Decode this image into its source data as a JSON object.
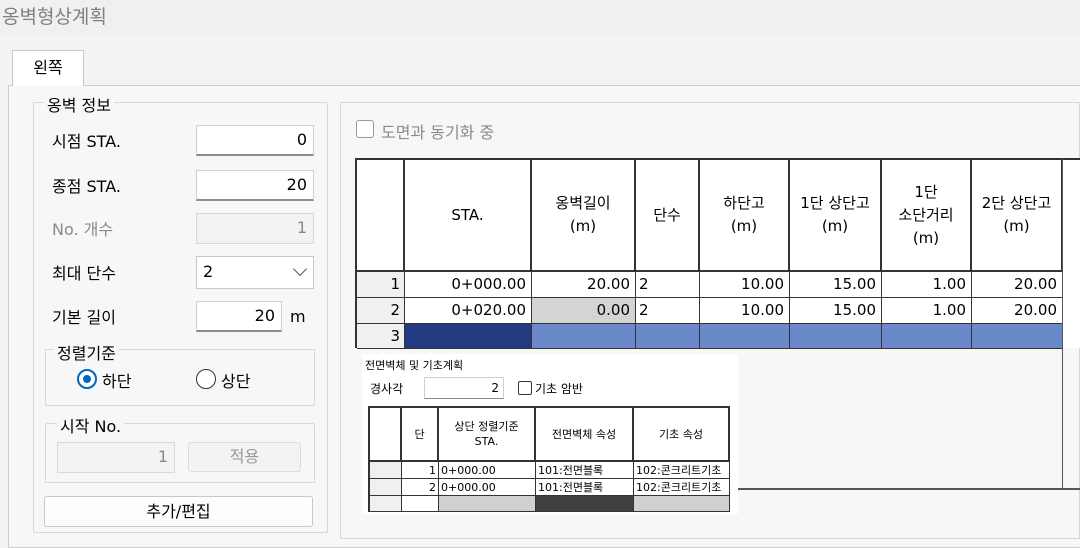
{
  "window": {
    "title": "옹벽형상계획"
  },
  "tabs": [
    {
      "label": "왼쪽"
    }
  ],
  "wall_info": {
    "group_label": "옹벽 정보",
    "start_sta": {
      "label": "시점 STA.",
      "value": "0"
    },
    "end_sta": {
      "label": "종점 STA.",
      "value": "20"
    },
    "count": {
      "label": "No. 개수",
      "value": "1"
    },
    "max_tiers": {
      "label": "최대 단수",
      "value": "2"
    },
    "base_length": {
      "label": "기본 길이",
      "value": "20",
      "unit": "m"
    },
    "alignment": {
      "group_label": "정렬기준",
      "options": [
        {
          "label": "하단",
          "selected": true
        },
        {
          "label": "상단",
          "selected": false
        }
      ]
    },
    "start_no": {
      "group_label": "시작 No.",
      "value": "1",
      "apply_label": "적용"
    },
    "add_edit_label": "추가/편집"
  },
  "sync": {
    "label": "도면과 동기화 중",
    "checked": false
  },
  "main_table": {
    "headers": [
      "STA.",
      "옹벽길이\n(m)",
      "단수",
      "하단고\n(m)",
      "1단 상단고\n(m)",
      "1단\n소단거리\n(m)",
      "2단 상단고\n(m)"
    ],
    "rows": [
      {
        "no": "1",
        "cells": [
          "0+000.00",
          "20.00",
          "2",
          "10.00",
          "15.00",
          "1.00",
          "20.00"
        ]
      },
      {
        "no": "2",
        "cells": [
          "0+020.00",
          "0.00",
          "2",
          "10.00",
          "15.00",
          "1.00",
          "20.00"
        ]
      },
      {
        "no": "3",
        "cells": [
          "",
          "",
          "",
          "",
          "",
          "",
          ""
        ]
      }
    ]
  },
  "front_panel": {
    "title": "전면벽체 및 기초계획",
    "slope": {
      "label": "경사각",
      "value": "2"
    },
    "hidden_base": {
      "label": "기초 암반",
      "checked": false
    },
    "headers": [
      "단",
      "상단 정렬기준\nSTA.",
      "전면벽체 속성",
      "기초 속성"
    ],
    "rows": [
      {
        "tier": "1",
        "sta": "0+000.00",
        "wall": "101:전면블록",
        "base": "102:콘크리트기초"
      },
      {
        "tier": "2",
        "sta": "0+000.00",
        "wall": "101:전면블록",
        "base": "102:콘크리트기초"
      }
    ]
  }
}
